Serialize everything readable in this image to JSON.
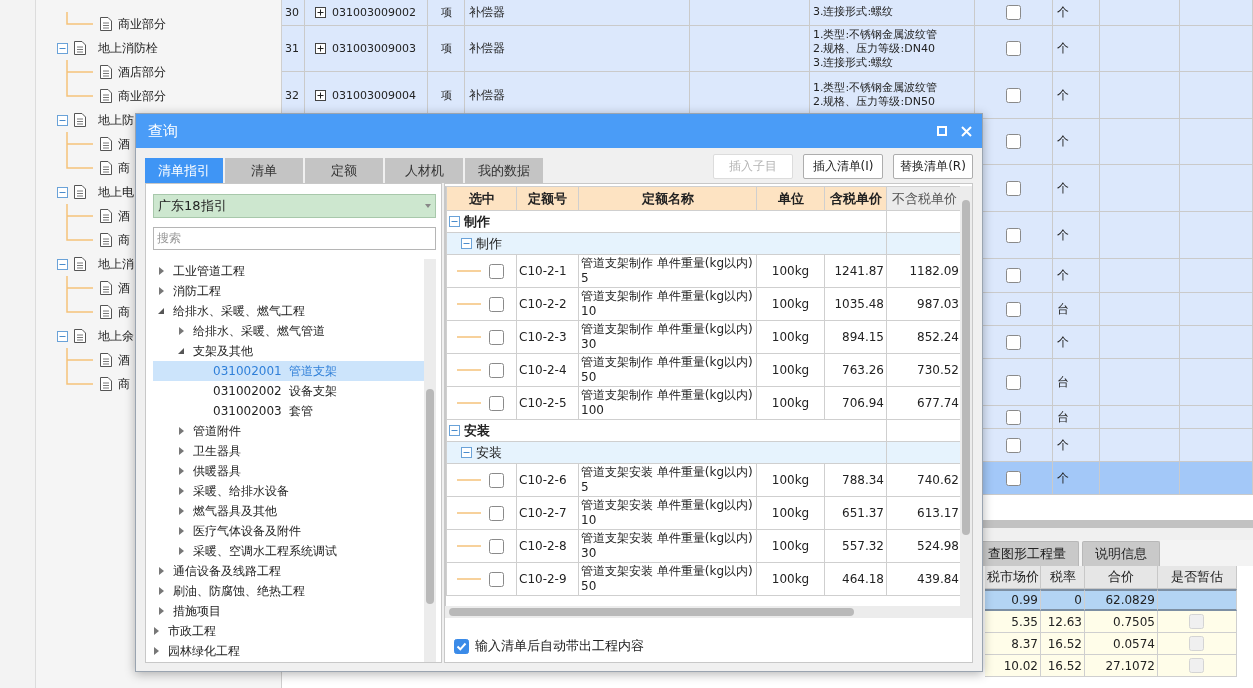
{
  "project_tree": [
    {
      "children": [
        {
          "label": "商业部分",
          "selected": false
        }
      ]
    },
    {
      "label": "地上消防栓",
      "expanded": true,
      "children": [
        {
          "label": "酒店部分",
          "selected": false
        },
        {
          "label": "商业部分",
          "selected": false
        }
      ]
    },
    {
      "label": "地上防",
      "expanded": true,
      "children": [
        {
          "label": "酒",
          "selected": false
        },
        {
          "label": "商",
          "selected": false
        }
      ]
    },
    {
      "label": "地上电",
      "expanded": true,
      "children": [
        {
          "label": "酒",
          "selected": false
        },
        {
          "label": "商",
          "selected": false
        }
      ]
    },
    {
      "label": "地上消",
      "expanded": true,
      "children": [
        {
          "label": "酒",
          "selected": false
        },
        {
          "label": "商",
          "selected": false
        }
      ]
    },
    {
      "label": "地上余",
      "expanded": true,
      "children": [
        {
          "label": "酒",
          "selected": false
        },
        {
          "label": "商",
          "selected": false
        }
      ]
    }
  ],
  "main_table": {
    "rows": [
      {
        "number": "30",
        "code": "031003009002",
        "type": "项",
        "name": "补偿器",
        "features": [
          "3.连接形式:螺纹"
        ],
        "checked": false,
        "unit": "个",
        "selected": false
      },
      {
        "number": "31",
        "code": "031003009003",
        "type": "项",
        "name": "补偿器",
        "features": [
          "1.类型:不锈钢金属波纹管",
          "2.规格、压力等级:DN40",
          "3.连接形式:螺纹"
        ],
        "checked": false,
        "unit": "个",
        "selected": false
      },
      {
        "number": "32",
        "code": "031003009004",
        "type": "项",
        "name": "补偿器",
        "features": [
          "1.类型:不锈钢金属波纹管",
          "2.规格、压力等级:DN50"
        ],
        "checked": false,
        "unit": "个",
        "selected": false
      },
      {
        "checked": false,
        "unit": "个",
        "selected": false
      },
      {
        "checked": false,
        "unit": "个",
        "selected": false
      },
      {
        "checked": false,
        "unit": "个",
        "selected": false
      },
      {
        "checked": false,
        "unit": "个",
        "selected": false
      },
      {
        "checked": false,
        "unit": "台",
        "selected": false
      },
      {
        "checked": false,
        "unit": "个",
        "selected": false
      },
      {
        "checked": false,
        "unit": "台",
        "selected": false
      },
      {
        "checked": false,
        "unit": "台",
        "selected": false
      },
      {
        "checked": false,
        "unit": "个",
        "selected": false
      },
      {
        "checked": false,
        "unit": "个",
        "selected": true
      }
    ]
  },
  "bottom_tabs": [
    {
      "label": "查图形工程量"
    },
    {
      "label": "说明信息"
    }
  ],
  "bottom_table": {
    "columns": [
      "税市场价",
      "税率",
      "合价",
      "是否暂估"
    ],
    "rows": [
      {
        "price": "0.99",
        "rate": "0",
        "total": "62.0829",
        "selected": true
      },
      {
        "price": "5.35",
        "rate": "12.63",
        "total": "0.7505",
        "selected": false,
        "provisional": false
      },
      {
        "price": "8.37",
        "rate": "16.52",
        "total": "0.0574",
        "selected": false,
        "provisional": false
      },
      {
        "price": "10.02",
        "rate": "16.52",
        "total": "27.1072",
        "selected": false,
        "provisional": false
      }
    ]
  },
  "dialog": {
    "title": "查询",
    "tabs": [
      {
        "label": "清单指引",
        "selected": true
      },
      {
        "label": "清单",
        "selected": false
      },
      {
        "label": "定额",
        "selected": false
      },
      {
        "label": "人材机",
        "selected": false
      },
      {
        "label": "我的数据",
        "selected": false
      }
    ],
    "buttons": [
      {
        "label": "插入子目",
        "disabled": true
      },
      {
        "label": "插入清单(I)",
        "disabled": false
      },
      {
        "label": "替换清单(R)",
        "disabled": false
      }
    ],
    "guide": {
      "select": "广东18指引",
      "search": {
        "placeholder": "搜索"
      },
      "tree": [
        {
          "children": [
            {
              "label": "工业管道工程",
              "expanded": false
            },
            {
              "label": "消防工程",
              "expanded": false
            },
            {
              "label": "给排水、采暖、燃气工程",
              "expanded": true,
              "children": [
                {
                  "label": "给排水、采暖、燃气管道",
                  "expanded": false
                },
                {
                  "label": "支架及其他",
                  "expanded": true,
                  "children": [
                    {
                      "code": "031002001",
                      "label": "管道支架",
                      "selected": true
                    },
                    {
                      "code": "031002002",
                      "label": "设备支架",
                      "selected": false
                    },
                    {
                      "code": "031002003",
                      "label": "套管",
                      "selected": false
                    }
                  ]
                },
                {
                  "label": "管道附件",
                  "expanded": false
                },
                {
                  "label": "卫生器具",
                  "expanded": false
                },
                {
                  "label": "供暖器具",
                  "expanded": false
                },
                {
                  "label": "采暖、给排水设备",
                  "expanded": false
                },
                {
                  "label": "燃气器具及其他",
                  "expanded": false
                },
                {
                  "label": "医疗气体设备及附件",
                  "expanded": false
                },
                {
                  "label": "采暖、空调水工程系统调试",
                  "expanded": false
                }
              ]
            },
            {
              "label": "通信设备及线路工程",
              "expanded": false
            },
            {
              "label": "刷油、防腐蚀、绝热工程",
              "expanded": false
            },
            {
              "label": "措施项目",
              "expanded": false
            }
          ]
        },
        {
          "label": "市政工程",
          "expanded": false
        },
        {
          "label": "园林绿化工程",
          "expanded": false
        }
      ]
    },
    "grid": {
      "columns": [
        {
          "label": "选中",
          "tinted": true
        },
        {
          "label": "定额号",
          "tinted": true
        },
        {
          "label": "定额名称",
          "tinted": true
        },
        {
          "label": "单位",
          "tinted": true
        },
        {
          "label": "含税单价",
          "tinted": true
        },
        {
          "label": "不含税单价",
          "tinted": false
        }
      ],
      "groups": [
        {
          "label": "制作",
          "expanded": true,
          "children": [
            {
              "label": "制作",
              "expanded": true,
              "rows": [
                {
                  "checked": false,
                  "code": "C10-2-1",
                  "name": "管道支架制作 单件重量(kg以内)\n5",
                  "unit": "100kg",
                  "price_tax": "1241.87",
                  "price_net": "1182.09"
                },
                {
                  "checked": false,
                  "code": "C10-2-2",
                  "name": "管道支架制作 单件重量(kg以内)\n10",
                  "unit": "100kg",
                  "price_tax": "1035.48",
                  "price_net": "987.03"
                },
                {
                  "checked": false,
                  "code": "C10-2-3",
                  "name": "管道支架制作 单件重量(kg以内)\n30",
                  "unit": "100kg",
                  "price_tax": "894.15",
                  "price_net": "852.24"
                },
                {
                  "checked": false,
                  "code": "C10-2-4",
                  "name": "管道支架制作 单件重量(kg以内)\n50",
                  "unit": "100kg",
                  "price_tax": "763.26",
                  "price_net": "730.52"
                },
                {
                  "checked": false,
                  "code": "C10-2-5",
                  "name": "管道支架制作 单件重量(kg以内)\n100",
                  "unit": "100kg",
                  "price_tax": "706.94",
                  "price_net": "677.74"
                }
              ]
            }
          ]
        },
        {
          "label": "安装",
          "expanded": true,
          "children": [
            {
              "label": "安装",
              "expanded": true,
              "rows": [
                {
                  "checked": false,
                  "code": "C10-2-6",
                  "name": "管道支架安装 单件重量(kg以内)\n5",
                  "unit": "100kg",
                  "price_tax": "788.34",
                  "price_net": "740.62"
                },
                {
                  "checked": false,
                  "code": "C10-2-7",
                  "name": "管道支架安装 单件重量(kg以内)\n10",
                  "unit": "100kg",
                  "price_tax": "651.37",
                  "price_net": "613.17"
                },
                {
                  "checked": false,
                  "code": "C10-2-8",
                  "name": "管道支架安装 单件重量(kg以内)\n30",
                  "unit": "100kg",
                  "price_tax": "557.32",
                  "price_net": "524.98"
                },
                {
                  "checked": false,
                  "code": "C10-2-9",
                  "name": "管道支架安装 单件重量(kg以内)\n50",
                  "unit": "100kg",
                  "price_tax": "464.18",
                  "price_net": "439.84"
                }
              ]
            }
          ]
        }
      ]
    },
    "auto_fill": {
      "label": "输入清单后自动带出工程内容",
      "checked": true
    }
  }
}
